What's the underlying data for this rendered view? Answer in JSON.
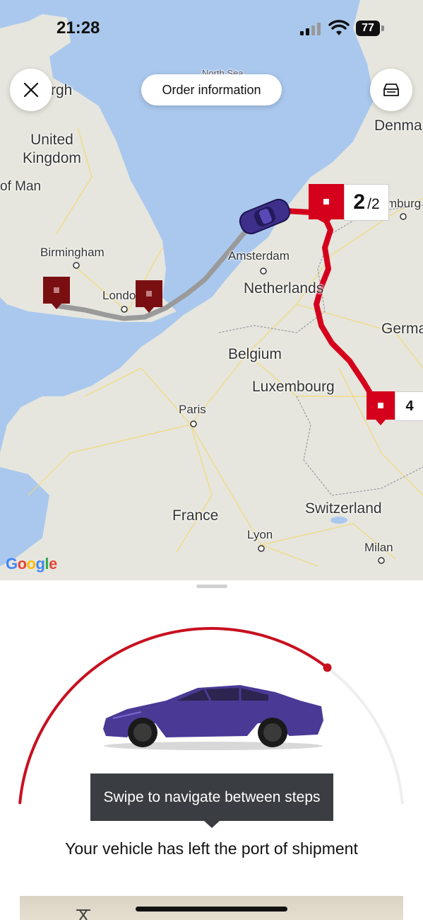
{
  "status_bar": {
    "time": "21:28",
    "battery": "77"
  },
  "header": {
    "order_button": "Order information"
  },
  "map": {
    "labels": {
      "edinburgh_partial": "rgh",
      "north_sea": "North Sea",
      "denmark_partial": "Denma",
      "united_kingdom": "United\nKingdom",
      "isle_of_man_partial": "of Man",
      "hamburg_partial": "mburg",
      "amsterdam": "Amsterdam",
      "birmingham": "Birmingham",
      "london": "London",
      "netherlands": "Netherlands",
      "germany_partial": "Germa",
      "belgium": "Belgium",
      "luxembourg": "Luxembourg",
      "paris": "Paris",
      "france": "France",
      "switzerland": "Switzerland",
      "lyon": "Lyon",
      "milan": "Milan"
    },
    "step_current": "2",
    "step_total": "/2",
    "step_next": "4",
    "attribution": "Google",
    "colors": {
      "route_active": "#d5001c",
      "route_past": "#9a9a9a",
      "pin_past": "#7a0f12",
      "water": "#aac8ee",
      "land": "#e8e8e2"
    }
  },
  "sheet": {
    "tooltip": "Swipe to navigate between steps",
    "status_message": "Your vehicle has left the port of shipment",
    "progress_fraction": 0.72,
    "progress_color": "#c8101f"
  }
}
